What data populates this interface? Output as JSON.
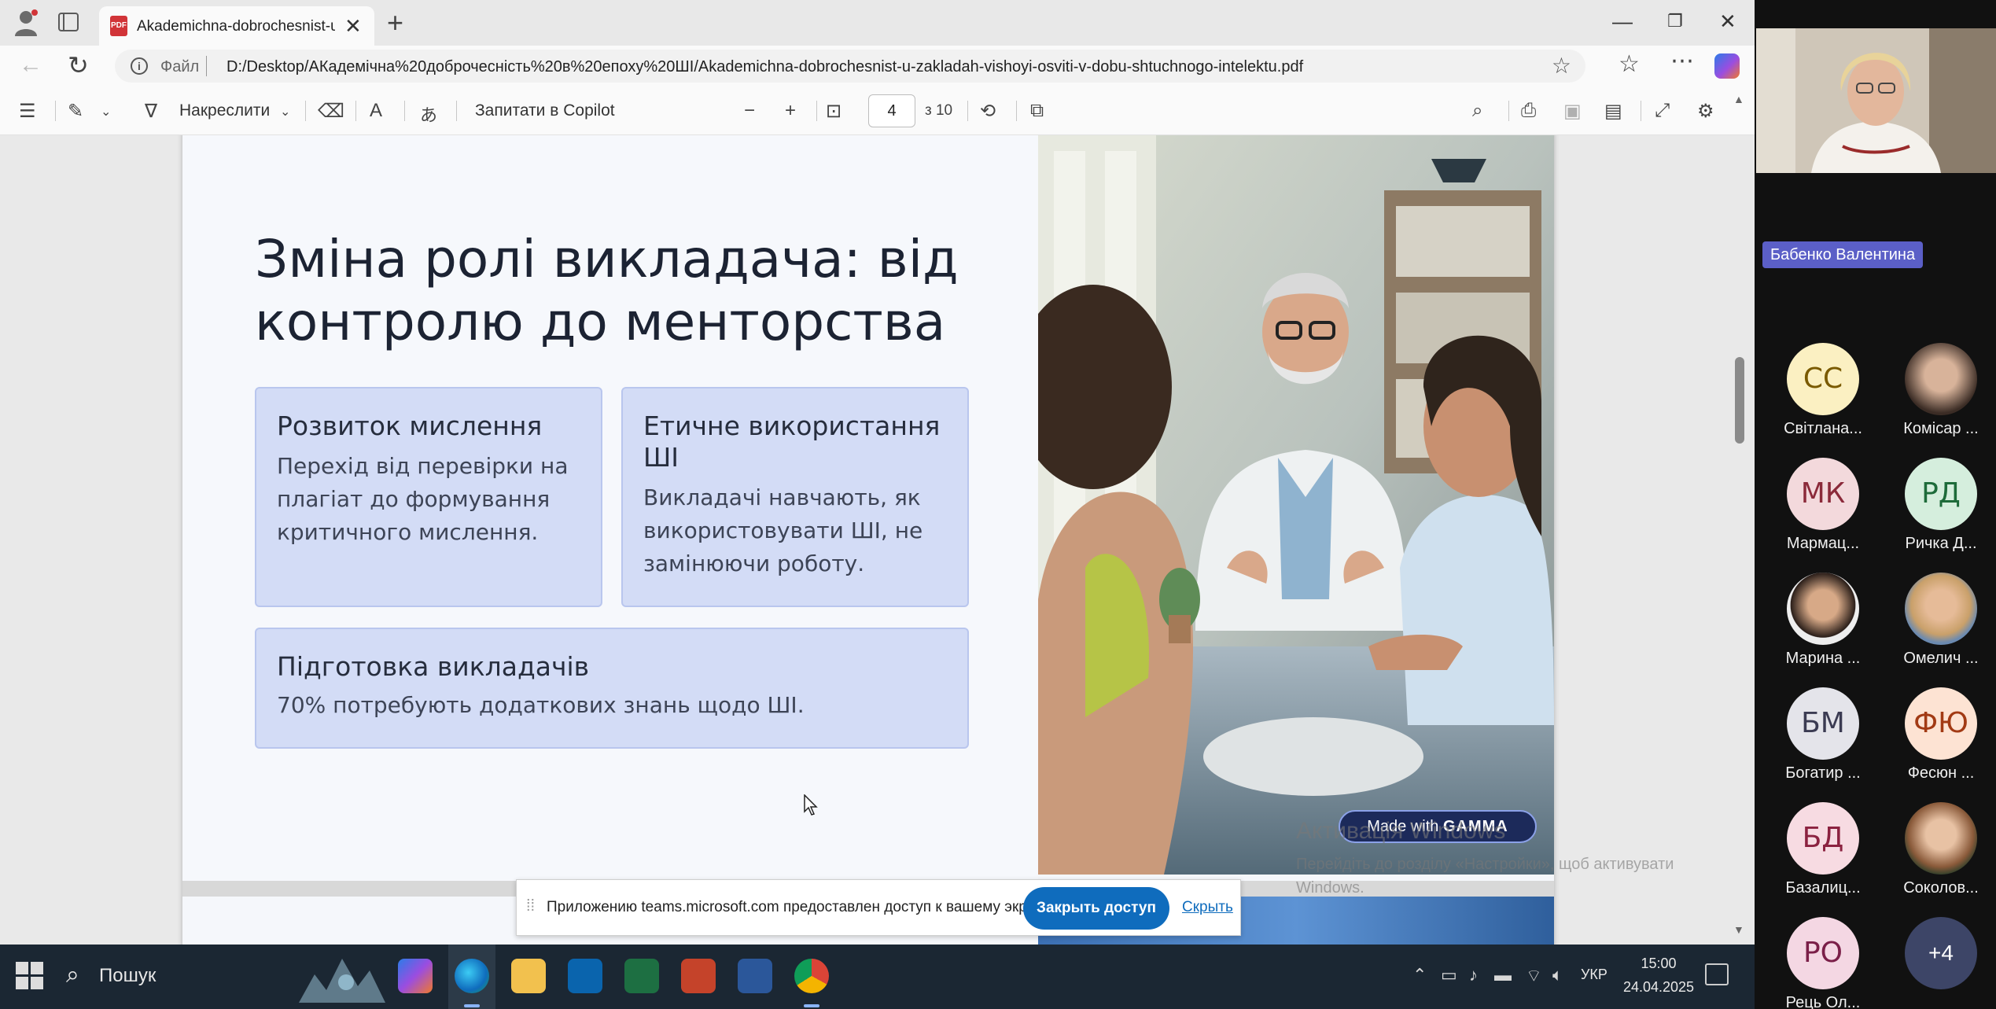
{
  "browser": {
    "tab_title": "Akademichna-dobrochesnist-u-za",
    "file_label": "Файл",
    "url": "D:/Desktop/AКадемічна%20доброчесність%20в%20епоху%20ШІ/Akademichna-dobrochesnist-u-zakladah-vishoyi-osviti-v-dobu-shtuchnogo-intelektu.pdf"
  },
  "pdf_toolbar": {
    "draw_label": "Накреслити",
    "copilot_label": "Запитати в Copilot",
    "page_number": "4",
    "page_total": "з 10"
  },
  "slide": {
    "title": "Зміна ролі викладача: від контролю до менторства",
    "cards": [
      {
        "title": "Розвиток мислення",
        "body": "Перехід від перевірки на плагіат до формування критичного мислення."
      },
      {
        "title": "Етичне використання ШІ",
        "body": "Викладачі навчають, як використовувати ШІ, не замінюючи роботу."
      },
      {
        "title": "Підготовка викладачів",
        "body": "70% потребують додаткових знань щодо ШІ."
      }
    ],
    "badge_prefix": "Made with",
    "badge_brand": "GAMMA"
  },
  "watermark": {
    "line1": "Активація Windows",
    "line2": "Перейдіть до розділу «Настройки», щоб активувати",
    "line3": "Windows."
  },
  "share_bar": {
    "text": "Приложению teams.microsoft.com предоставлен доступ к вашему экрану.",
    "stop_label": "Закрыть доступ",
    "hide_label": "Скрыть"
  },
  "taskbar": {
    "search_label": "Пошук",
    "language": "УКР",
    "time": "15:00",
    "date": "24.04.2025"
  },
  "teams": {
    "presenter_name": "Бабенко Валентина",
    "participants": [
      {
        "initials": "СС",
        "name": "Світлана..."
      },
      {
        "initials": "",
        "name": "Комісар ..."
      },
      {
        "initials": "МК",
        "name": "Мармац..."
      },
      {
        "initials": "РД",
        "name": "Ричка Д..."
      },
      {
        "initials": "",
        "name": "Марина ..."
      },
      {
        "initials": "",
        "name": "Омелич ..."
      },
      {
        "initials": "БМ",
        "name": "Богатир ..."
      },
      {
        "initials": "ФЮ",
        "name": "Фесюн ..."
      },
      {
        "initials": "БД",
        "name": "Базалиц..."
      },
      {
        "initials": "",
        "name": "Соколов..."
      },
      {
        "initials": "РО",
        "name": "Рець Ол..."
      }
    ],
    "more_count": "+4"
  },
  "colors": {
    "card_bg": "#d3dcf6",
    "teams_accent": "#5b5fc7",
    "share_button": "#0f6cbd"
  }
}
